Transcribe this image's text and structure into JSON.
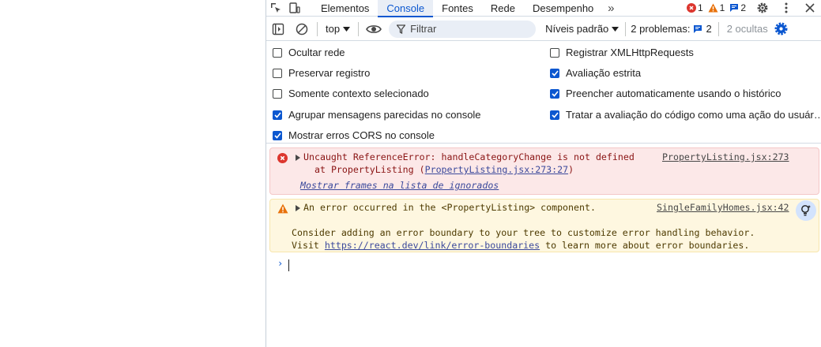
{
  "tabs": [
    {
      "label": "Elementos"
    },
    {
      "label": "Console"
    },
    {
      "label": "Fontes"
    },
    {
      "label": "Rede"
    },
    {
      "label": "Desempenho"
    }
  ],
  "counters": {
    "errors": "1",
    "warnings": "1",
    "issues": "2"
  },
  "toolbar": {
    "context": "top",
    "filter_placeholder": "Filtrar",
    "levels": "Níveis padrão",
    "problems_label": "2 problemas:",
    "problems_count": "2",
    "hidden": "2 ocultas"
  },
  "settings": {
    "left": [
      {
        "label": "Ocultar rede",
        "checked": false
      },
      {
        "label": "Preservar registro",
        "checked": false
      },
      {
        "label": "Somente contexto selecionado",
        "checked": false
      },
      {
        "label": "Agrupar mensagens parecidas no console",
        "checked": true
      },
      {
        "label": "Mostrar erros CORS no console",
        "checked": true
      }
    ],
    "right": [
      {
        "label": "Registrar XMLHttpRequests",
        "checked": false
      },
      {
        "label": "Avaliação estrita",
        "checked": true
      },
      {
        "label": "Preencher automaticamente usando o histórico",
        "checked": true
      },
      {
        "label": "Tratar a avaliação do código como uma ação do usuár…",
        "checked": true
      }
    ]
  },
  "messages": {
    "error": {
      "text": "Uncaught ReferenceError: handleCategoryChange is not defined",
      "stack_prefix": "at PropertyListing (",
      "stack_link": "PropertyListing.jsx:273:27",
      "stack_suffix": ")",
      "ignored_frames": "Mostrar frames na lista de ignorados",
      "source": "PropertyListing.jsx:273"
    },
    "warning": {
      "text": "An error occurred in the <PropertyListing> component.",
      "source": "SingleFamilyHomes.jsx:42",
      "line2": "Consider adding an error boundary to your tree to customize error handling behavior.",
      "line3_prefix": "Visit ",
      "line3_link": "https://react.dev/link/error-boundaries",
      "line3_suffix": " to learn more about error boundaries."
    }
  },
  "colors": {
    "accent": "#0b57d0",
    "error": "#dc362e",
    "warning": "#e8710a"
  }
}
